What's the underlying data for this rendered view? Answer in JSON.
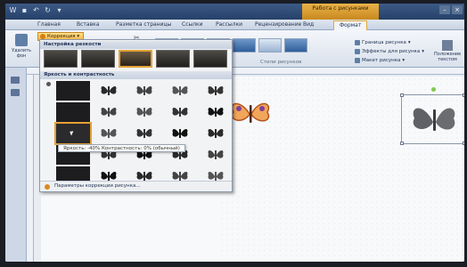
{
  "tabs": {
    "home": "Главная",
    "insert": "Вставка",
    "layout": "Разметка страницы",
    "refs": "Ссылки",
    "mailings": "Рассылки",
    "review": "Рецензирование",
    "view": "Вид",
    "format": "Формат"
  },
  "context_tab": "Работа с рисунками",
  "ribbon": {
    "remove_bg": "Удалить фон",
    "corrections": "Коррекция",
    "styles_group": "Стили рисунков",
    "border": "Граница рисунка",
    "effects": "Эффекты для рисунка",
    "layout": "Макет рисунка",
    "position": "Положение текстом"
  },
  "dropdown": {
    "sharpen_header": "Настройка резкости",
    "brightness_header": "Яркость и контрастность",
    "tooltip": "Яркость: -40% Контрастность: 0% (обычный)",
    "footer": "Параметры коррекции рисунка..."
  },
  "colors": {
    "accent": "#e4a136",
    "ribbon_blue": "#26416a"
  }
}
